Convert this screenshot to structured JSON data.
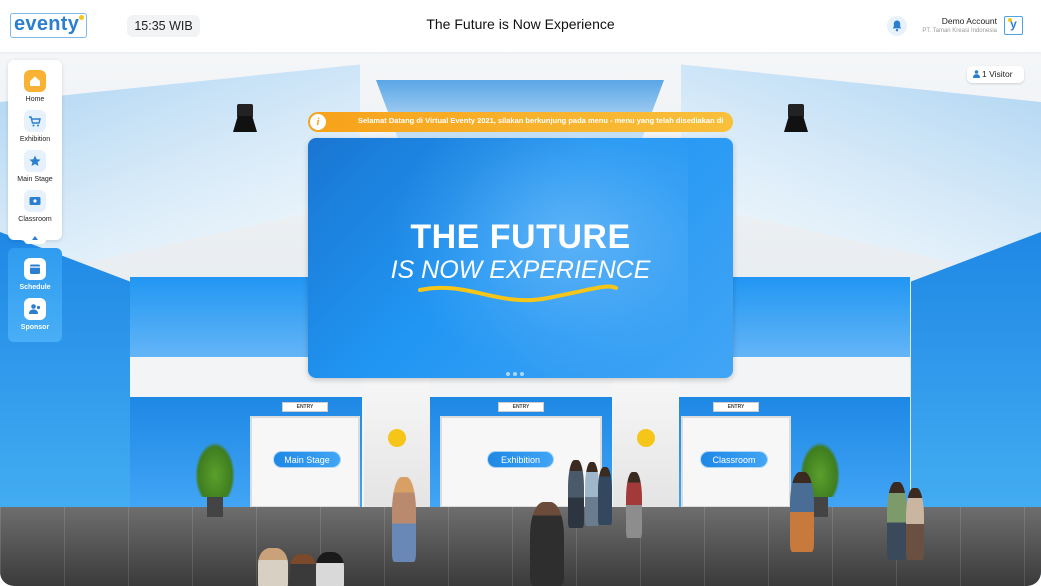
{
  "app": {
    "logo_text": "eventy",
    "time": "15:35 WIB",
    "title": "The Future is Now Experience"
  },
  "account": {
    "name": "Demo Account",
    "organization": "PT. Taman Kreasi Indonesia",
    "logo_letter": "y"
  },
  "visitor": {
    "label": "1 Visitor",
    "icon": "person-icon"
  },
  "announcement": {
    "icon": "i",
    "text": "Selamat Datang di Virtual Eventy 2021, silakan berkunjung pada menu - menu yang telah disediakan di"
  },
  "screen": {
    "headline": "THE FUTURE",
    "subline": "IS NOW EXPERIENCE"
  },
  "sidebar": {
    "items": [
      {
        "label": "Home",
        "icon": "home-icon"
      },
      {
        "label": "Exhibition",
        "icon": "cart-icon"
      },
      {
        "label": "Main Stage",
        "icon": "star-icon"
      },
      {
        "label": "Classroom",
        "icon": "classroom-icon"
      }
    ],
    "extra": [
      {
        "label": "Schedule",
        "icon": "calendar-icon"
      },
      {
        "label": "Sponsor",
        "icon": "sponsor-icon"
      }
    ]
  },
  "rooms": {
    "main_stage": "Main Stage",
    "exhibition": "Exhibition",
    "classroom": "Classroom",
    "entry_label": "ENTRY"
  },
  "colors": {
    "brand_blue": "#2b7fcf",
    "accent_orange": "#f7a21a",
    "accent_yellow": "#f5c518",
    "home_icon_bg": "#f9b233"
  }
}
